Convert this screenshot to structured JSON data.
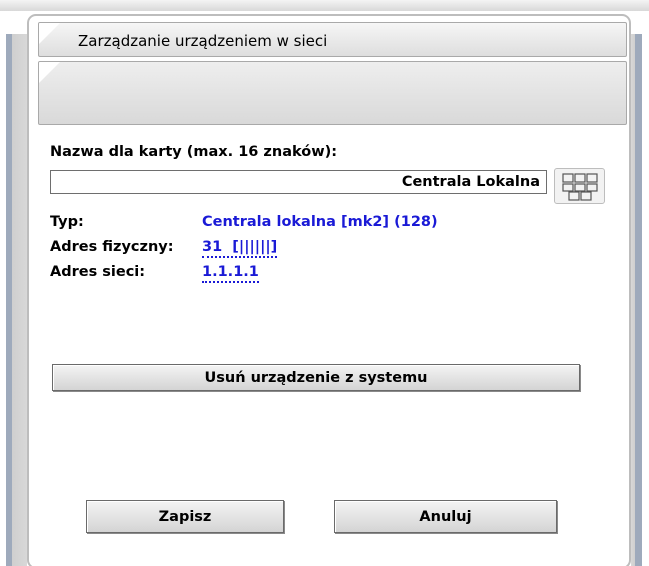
{
  "dialog": {
    "title": "Zarządzanie urządzeniem w sieci",
    "subtitle": ""
  },
  "form": {
    "name_label": "Nazwa dla karty (max. 16 znaków):",
    "name_value": "Centrala Lokalna",
    "grid_button_icon": "grid-icon"
  },
  "info": {
    "type_label": "Typ:",
    "type_value": "Centrala lokalna [mk2] (128)",
    "physical_label": "Adres fizyczny:",
    "physical_value": "31  [||||||]",
    "network_label": "Adres sieci:",
    "network_value": "1.1.1.1"
  },
  "buttons": {
    "remove": "Usuń urządzenie z systemu",
    "save": "Zapisz",
    "cancel": "Anuluj"
  },
  "colors": {
    "link": "#1a1ad6",
    "panel": "#dedede"
  }
}
